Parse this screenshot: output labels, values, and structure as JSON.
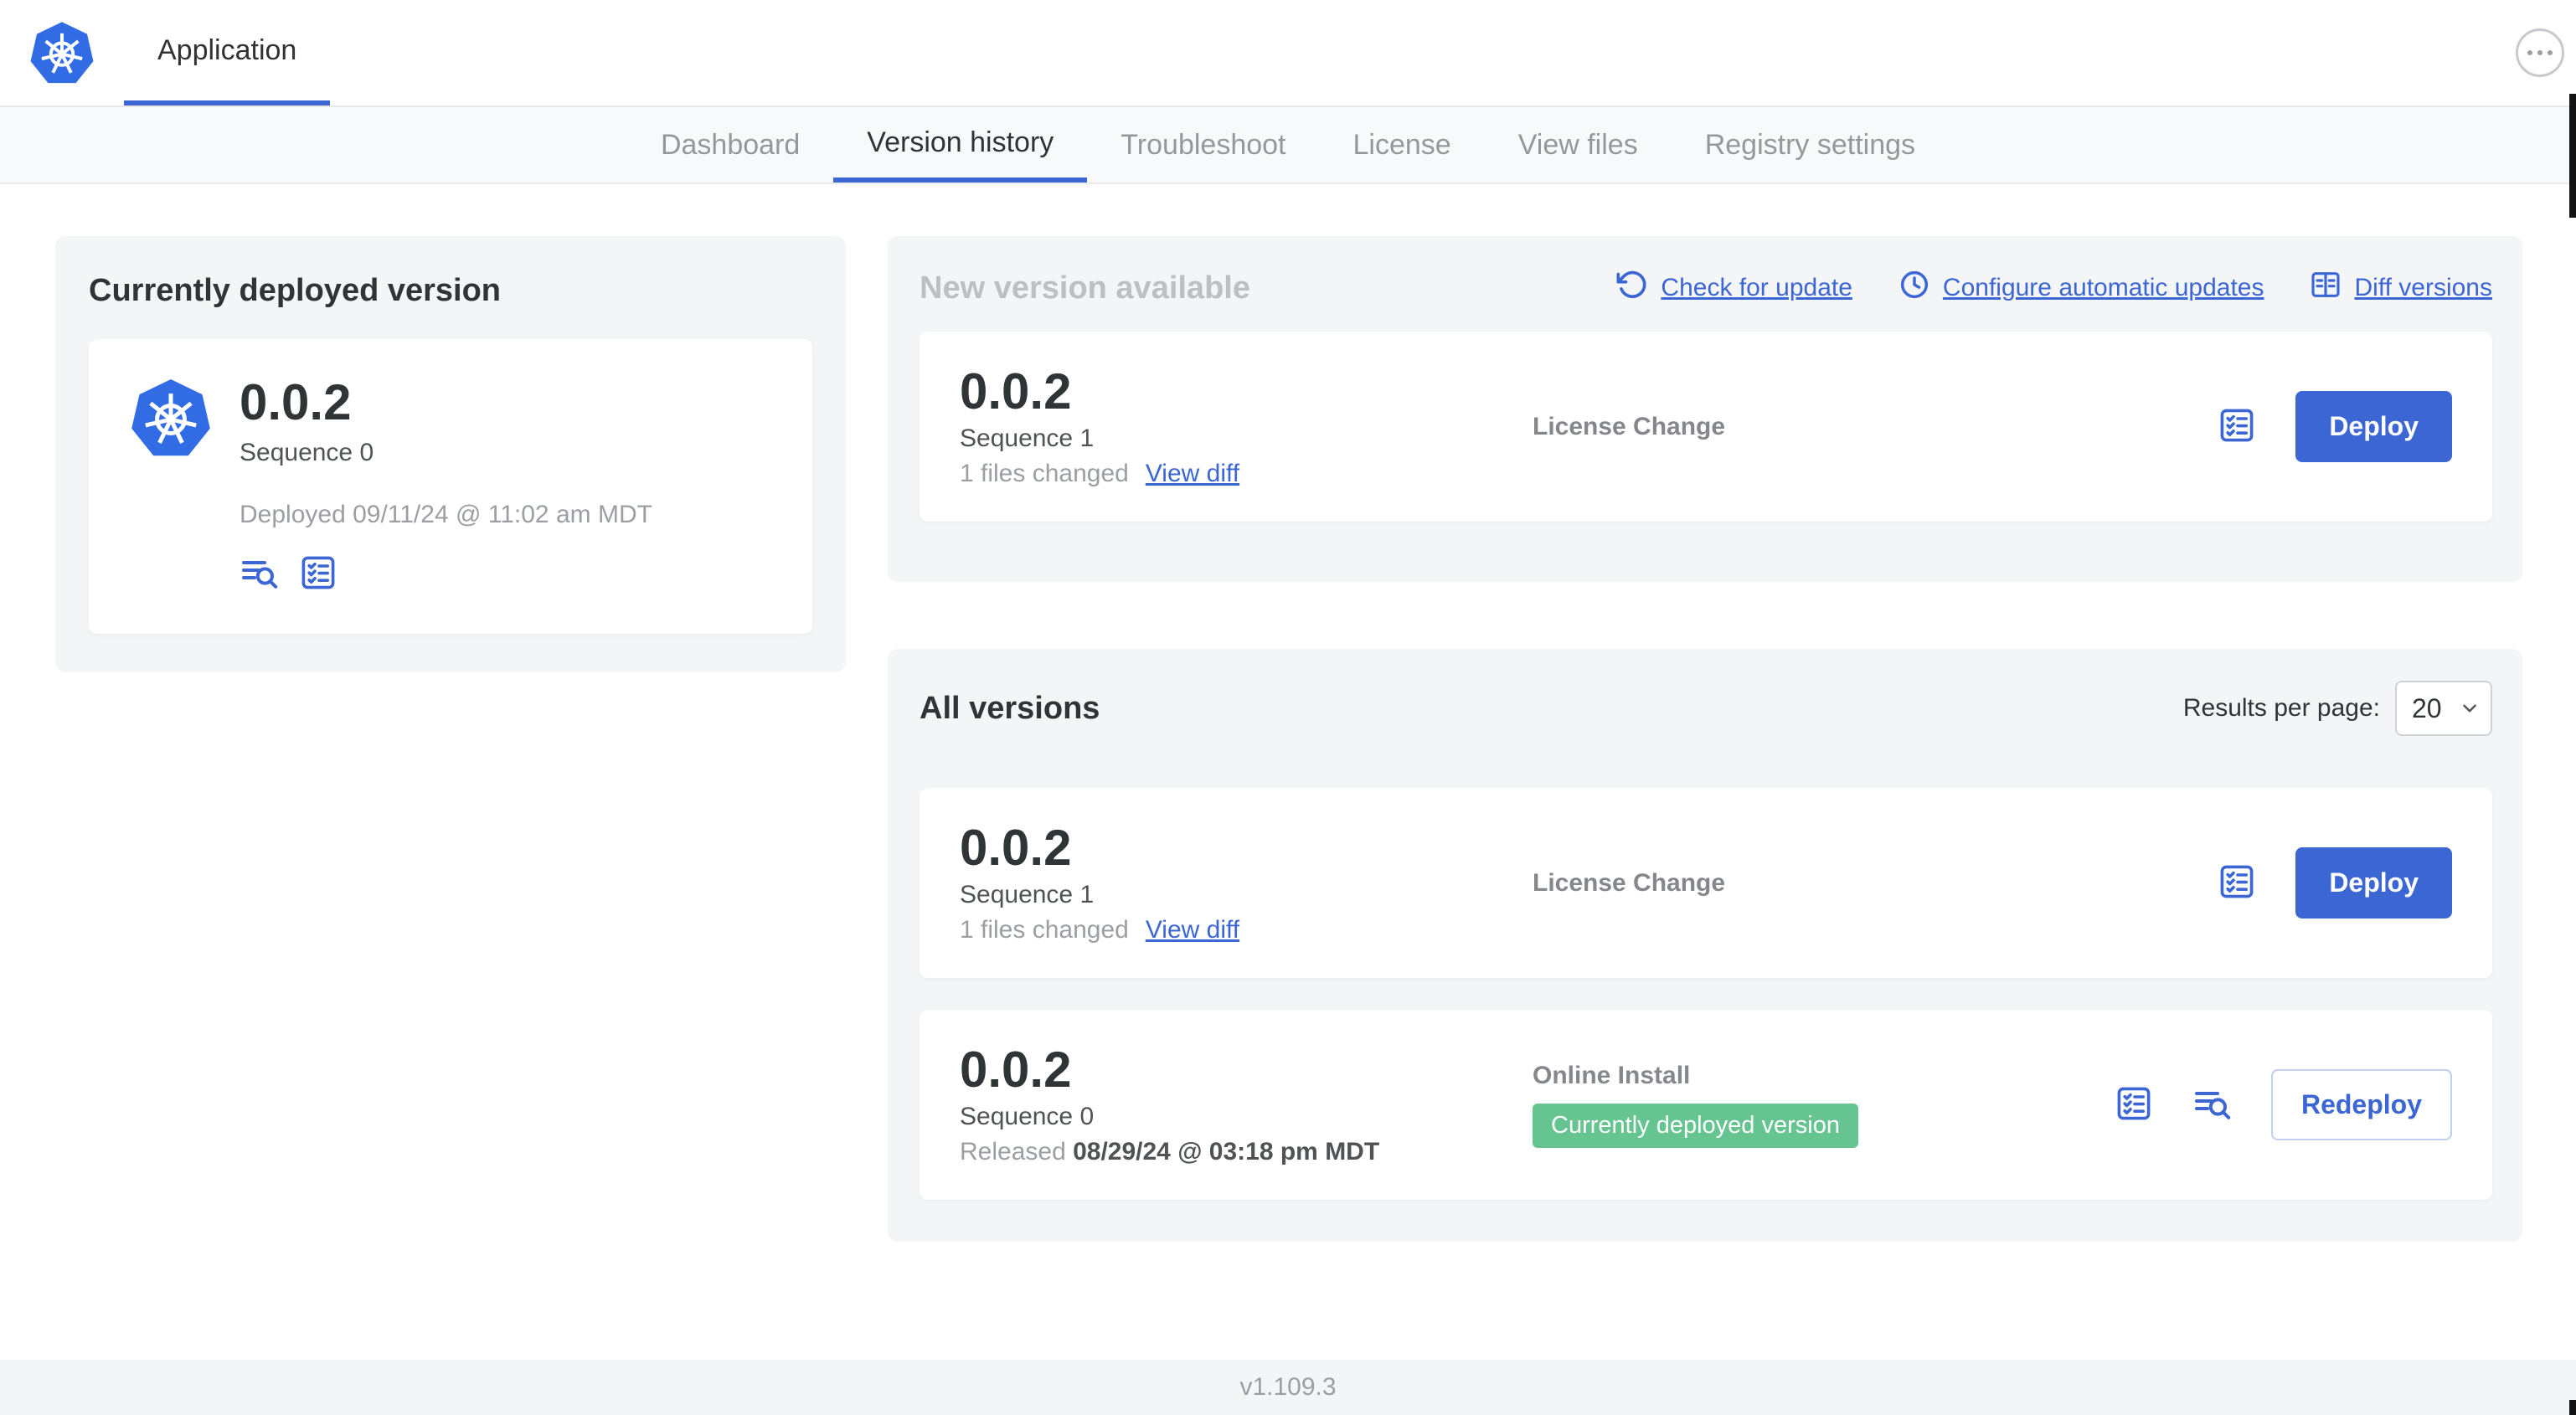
{
  "colors": {
    "accent": "#3b66d3",
    "k8s_blue": "#326ce5",
    "badge_green": "#65c48f"
  },
  "icons": {
    "logo": "kubernetes-logo",
    "menu": "ellipsis-icon",
    "check_update": "refresh-icon",
    "auto_update": "clock-icon",
    "diff": "diff-table-icon",
    "release_notes": "checklist-icon",
    "logs": "log-search-icon",
    "select": "chevron-down-icon"
  },
  "header": {
    "app_tab": "Application"
  },
  "nav": {
    "tabs": [
      {
        "label": "Dashboard",
        "active": false
      },
      {
        "label": "Version history",
        "active": true
      },
      {
        "label": "Troubleshoot",
        "active": false
      },
      {
        "label": "License",
        "active": false
      },
      {
        "label": "View files",
        "active": false
      },
      {
        "label": "Registry settings",
        "active": false
      }
    ]
  },
  "currently_deployed": {
    "title": "Currently deployed version",
    "version": "0.0.2",
    "sequence": "Sequence 0",
    "deployed": "Deployed 09/11/24 @ 11:02 am MDT"
  },
  "new_version": {
    "title": "New version available",
    "check_for_update": "Check for update",
    "configure_updates": "Configure automatic updates",
    "diff_versions": "Diff versions",
    "card": {
      "version": "0.0.2",
      "sequence": "Sequence 1",
      "files_changed": "1 files changed",
      "view_diff": "View diff",
      "source": "License Change",
      "action": "Deploy"
    }
  },
  "all_versions": {
    "title": "All versions",
    "results_label": "Results per page:",
    "results_value": "20",
    "rows": [
      {
        "version": "0.0.2",
        "sequence": "Sequence 1",
        "files_changed": "1 files changed",
        "view_diff": "View diff",
        "source": "License Change",
        "action": "Deploy"
      },
      {
        "version": "0.0.2",
        "sequence": "Sequence 0",
        "released_prefix": "Released ",
        "released_date": "08/29/24 @ 03:18 pm MDT",
        "source": "Online Install",
        "badge": "Currently deployed version",
        "action": "Redeploy"
      }
    ]
  },
  "footer": {
    "version": "v1.109.3"
  }
}
